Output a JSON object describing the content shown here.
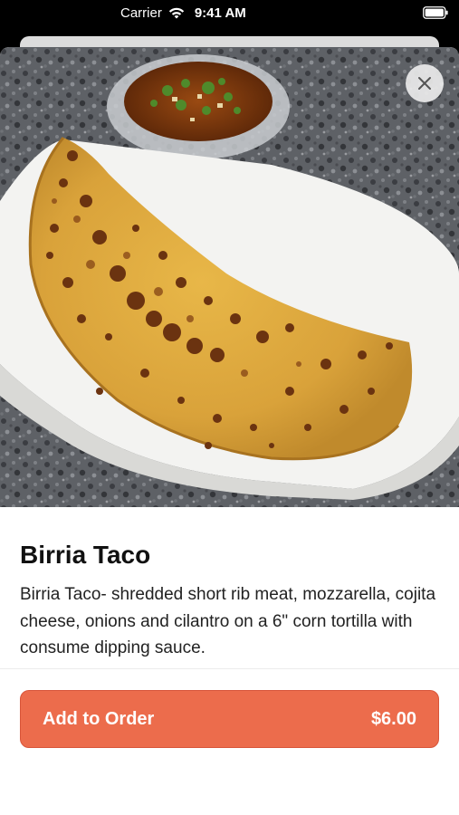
{
  "status_bar": {
    "carrier": "Carrier",
    "time": "9:41 AM",
    "icons": [
      "wifi-icon",
      "battery-icon"
    ]
  },
  "item": {
    "title": "Birria Taco",
    "description": "Birria Taco- shredded short rib meat, mozzarella, cojita cheese, onions and cilantro on a 6\" corn tortilla with consume dipping sauce.",
    "image_alt": "Birria taco in a paper tray with a cup of consome"
  },
  "actions": {
    "close_icon": "close-icon",
    "add_label": "Add to Order",
    "price": "$6.00"
  },
  "colors": {
    "accent": "#ec6c4c",
    "status_bar_bg": "#000000"
  }
}
